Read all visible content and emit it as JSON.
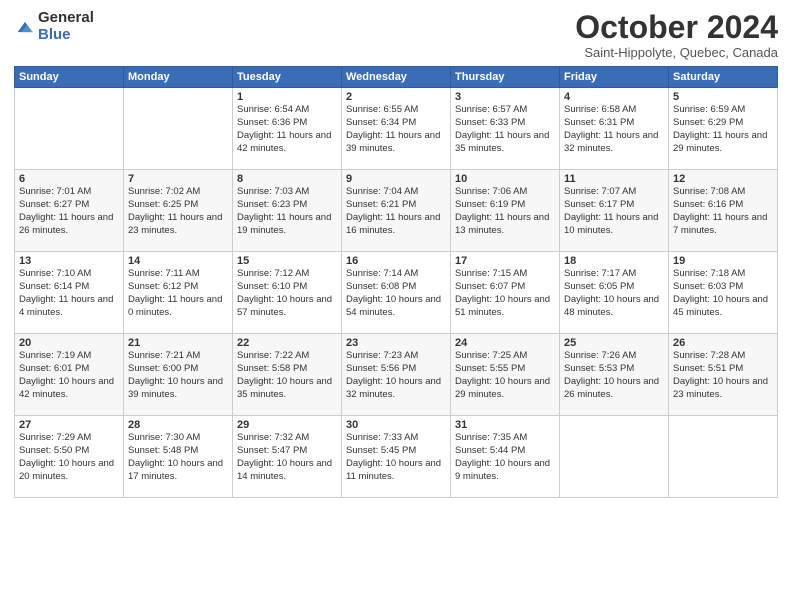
{
  "logo": {
    "general": "General",
    "blue": "Blue"
  },
  "title": "October 2024",
  "location": "Saint-Hippolyte, Quebec, Canada",
  "headers": [
    "Sunday",
    "Monday",
    "Tuesday",
    "Wednesday",
    "Thursday",
    "Friday",
    "Saturday"
  ],
  "weeks": [
    [
      {
        "day": "",
        "info": ""
      },
      {
        "day": "",
        "info": ""
      },
      {
        "day": "1",
        "info": "Sunrise: 6:54 AM\nSunset: 6:36 PM\nDaylight: 11 hours and 42 minutes."
      },
      {
        "day": "2",
        "info": "Sunrise: 6:55 AM\nSunset: 6:34 PM\nDaylight: 11 hours and 39 minutes."
      },
      {
        "day": "3",
        "info": "Sunrise: 6:57 AM\nSunset: 6:33 PM\nDaylight: 11 hours and 35 minutes."
      },
      {
        "day": "4",
        "info": "Sunrise: 6:58 AM\nSunset: 6:31 PM\nDaylight: 11 hours and 32 minutes."
      },
      {
        "day": "5",
        "info": "Sunrise: 6:59 AM\nSunset: 6:29 PM\nDaylight: 11 hours and 29 minutes."
      }
    ],
    [
      {
        "day": "6",
        "info": "Sunrise: 7:01 AM\nSunset: 6:27 PM\nDaylight: 11 hours and 26 minutes."
      },
      {
        "day": "7",
        "info": "Sunrise: 7:02 AM\nSunset: 6:25 PM\nDaylight: 11 hours and 23 minutes."
      },
      {
        "day": "8",
        "info": "Sunrise: 7:03 AM\nSunset: 6:23 PM\nDaylight: 11 hours and 19 minutes."
      },
      {
        "day": "9",
        "info": "Sunrise: 7:04 AM\nSunset: 6:21 PM\nDaylight: 11 hours and 16 minutes."
      },
      {
        "day": "10",
        "info": "Sunrise: 7:06 AM\nSunset: 6:19 PM\nDaylight: 11 hours and 13 minutes."
      },
      {
        "day": "11",
        "info": "Sunrise: 7:07 AM\nSunset: 6:17 PM\nDaylight: 11 hours and 10 minutes."
      },
      {
        "day": "12",
        "info": "Sunrise: 7:08 AM\nSunset: 6:16 PM\nDaylight: 11 hours and 7 minutes."
      }
    ],
    [
      {
        "day": "13",
        "info": "Sunrise: 7:10 AM\nSunset: 6:14 PM\nDaylight: 11 hours and 4 minutes."
      },
      {
        "day": "14",
        "info": "Sunrise: 7:11 AM\nSunset: 6:12 PM\nDaylight: 11 hours and 0 minutes."
      },
      {
        "day": "15",
        "info": "Sunrise: 7:12 AM\nSunset: 6:10 PM\nDaylight: 10 hours and 57 minutes."
      },
      {
        "day": "16",
        "info": "Sunrise: 7:14 AM\nSunset: 6:08 PM\nDaylight: 10 hours and 54 minutes."
      },
      {
        "day": "17",
        "info": "Sunrise: 7:15 AM\nSunset: 6:07 PM\nDaylight: 10 hours and 51 minutes."
      },
      {
        "day": "18",
        "info": "Sunrise: 7:17 AM\nSunset: 6:05 PM\nDaylight: 10 hours and 48 minutes."
      },
      {
        "day": "19",
        "info": "Sunrise: 7:18 AM\nSunset: 6:03 PM\nDaylight: 10 hours and 45 minutes."
      }
    ],
    [
      {
        "day": "20",
        "info": "Sunrise: 7:19 AM\nSunset: 6:01 PM\nDaylight: 10 hours and 42 minutes."
      },
      {
        "day": "21",
        "info": "Sunrise: 7:21 AM\nSunset: 6:00 PM\nDaylight: 10 hours and 39 minutes."
      },
      {
        "day": "22",
        "info": "Sunrise: 7:22 AM\nSunset: 5:58 PM\nDaylight: 10 hours and 35 minutes."
      },
      {
        "day": "23",
        "info": "Sunrise: 7:23 AM\nSunset: 5:56 PM\nDaylight: 10 hours and 32 minutes."
      },
      {
        "day": "24",
        "info": "Sunrise: 7:25 AM\nSunset: 5:55 PM\nDaylight: 10 hours and 29 minutes."
      },
      {
        "day": "25",
        "info": "Sunrise: 7:26 AM\nSunset: 5:53 PM\nDaylight: 10 hours and 26 minutes."
      },
      {
        "day": "26",
        "info": "Sunrise: 7:28 AM\nSunset: 5:51 PM\nDaylight: 10 hours and 23 minutes."
      }
    ],
    [
      {
        "day": "27",
        "info": "Sunrise: 7:29 AM\nSunset: 5:50 PM\nDaylight: 10 hours and 20 minutes."
      },
      {
        "day": "28",
        "info": "Sunrise: 7:30 AM\nSunset: 5:48 PM\nDaylight: 10 hours and 17 minutes."
      },
      {
        "day": "29",
        "info": "Sunrise: 7:32 AM\nSunset: 5:47 PM\nDaylight: 10 hours and 14 minutes."
      },
      {
        "day": "30",
        "info": "Sunrise: 7:33 AM\nSunset: 5:45 PM\nDaylight: 10 hours and 11 minutes."
      },
      {
        "day": "31",
        "info": "Sunrise: 7:35 AM\nSunset: 5:44 PM\nDaylight: 10 hours and 9 minutes."
      },
      {
        "day": "",
        "info": ""
      },
      {
        "day": "",
        "info": ""
      }
    ]
  ]
}
